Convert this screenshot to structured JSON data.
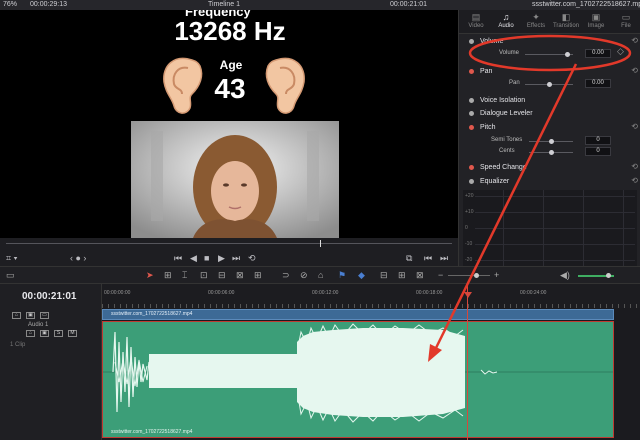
{
  "topbar": {
    "zoom": "76%",
    "source_timecode": "00:00:29:13",
    "timeline_title": "Timeline 1",
    "record_timecode": "00:00:21:01",
    "clip_name": "ssstwitter.com_1702722518627.mp4"
  },
  "viewer": {
    "heading_partial": "Frequency",
    "frequency": "13268 Hz",
    "age_label": "Age",
    "age_value": "43"
  },
  "inspector": {
    "tabs": [
      {
        "label": "Video",
        "icon": "film-icon"
      },
      {
        "label": "Audio",
        "icon": "music-note-icon"
      },
      {
        "label": "Effects",
        "icon": "wand-icon"
      },
      {
        "label": "Transition",
        "icon": "transition-icon"
      },
      {
        "label": "Image",
        "icon": "image-icon"
      },
      {
        "label": "File",
        "icon": "file-icon"
      }
    ],
    "volume_section": "Volume",
    "volume_label": "Volume",
    "volume_value": "0.00",
    "pan_section": "Pan",
    "pan_label": "Pan",
    "pan_value": "0.00",
    "voice_isolation": "Voice Isolation",
    "dialogue_leveler": "Dialogue Leveler",
    "pitch_section": "Pitch",
    "semi_tones_label": "Semi Tones",
    "semi_tones_value": "0",
    "cents_label": "Cents",
    "cents_value": "0",
    "speed_change": "Speed Change",
    "equalizer": "Equalizer",
    "eq_y_labels": [
      "+20",
      "+10",
      "0",
      "-10",
      "-20"
    ]
  },
  "timeline": {
    "timecode": "00:00:21:01",
    "ruler_labels": [
      "00:00:00:00",
      "00:00:06:00",
      "00:00:12:00",
      "00:00:18:00",
      "00:00:24:00"
    ],
    "video_clip_name": "ssstwitter.com_1702722518627.mp4",
    "audio_clip_name": "ssstwitter.com_1702722518627.mp4",
    "audio_track_label": "1 Clip",
    "audio_track_name": "Audio 1"
  },
  "colors": {
    "accent_red": "#d6483c",
    "audio_clip": "#3c9e78",
    "video_clip": "#3d6a96"
  }
}
